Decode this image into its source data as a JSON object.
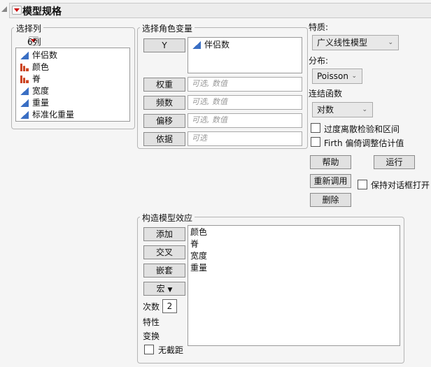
{
  "header": {
    "title": "模型规格"
  },
  "columns": {
    "label": "选择列",
    "count": "6列",
    "items": [
      {
        "name": "伴侣数",
        "type": "continuous"
      },
      {
        "name": "颜色",
        "type": "nominal"
      },
      {
        "name": "脊",
        "type": "nominal"
      },
      {
        "name": "宽度",
        "type": "continuous"
      },
      {
        "name": "重量",
        "type": "continuous"
      },
      {
        "name": "标准化重量",
        "type": "continuous"
      }
    ]
  },
  "roles": {
    "label": "选择角色变量",
    "y_button": "Y",
    "y_value": "伴侣数",
    "rows": [
      {
        "button": "权重",
        "placeholder": "可选, 数值"
      },
      {
        "button": "频数",
        "placeholder": "可选, 数值"
      },
      {
        "button": "偏移",
        "placeholder": "可选, 数值"
      },
      {
        "button": "依据",
        "placeholder": "可选"
      }
    ]
  },
  "options": {
    "personality_label": "特质:",
    "personality": "广义线性模型",
    "distribution_label": "分布:",
    "distribution": "Poisson",
    "link_label": "连结函数",
    "link": "对数",
    "overdispersion": "过度离散检验和区间",
    "firth": "Firth 偏倚调整估计值"
  },
  "actions": {
    "help": "帮助",
    "run": "运行",
    "recall": "重新调用",
    "keep_open": "保持对话框打开",
    "remove": "删除"
  },
  "effects": {
    "label": "构造模型效应",
    "add": "添加",
    "cross": "交叉",
    "nest": "嵌套",
    "macros": "宏",
    "degree_label": "次数",
    "degree": "2",
    "attributes": "特性",
    "transform": "变换",
    "no_intercept": "无截距",
    "items": [
      "颜色",
      "脊",
      "宽度",
      "重量"
    ]
  }
}
